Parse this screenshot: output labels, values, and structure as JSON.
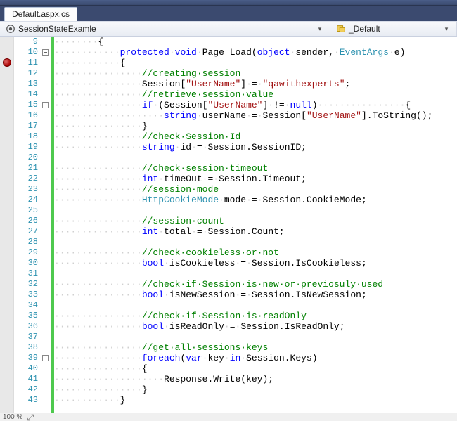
{
  "tab": {
    "filename": "Default.aspx.cs"
  },
  "nav": {
    "scope": "SessionStateExamle",
    "member_prefix": "",
    "member": "_Default"
  },
  "breakpoint_line": 11,
  "outline_toggles": [
    10,
    15,
    39
  ],
  "zoom": "100 %",
  "code_lines": [
    {
      "n": 9,
      "indent": 2,
      "tokens": [
        {
          "t": "txt",
          "v": "{"
        }
      ]
    },
    {
      "n": 10,
      "indent": 3,
      "tokens": [
        {
          "t": "kw",
          "v": "protected"
        },
        {
          "t": "ws",
          "v": "·"
        },
        {
          "t": "kw",
          "v": "void"
        },
        {
          "t": "ws",
          "v": "·"
        },
        {
          "t": "txt",
          "v": "Page_Load("
        },
        {
          "t": "kw",
          "v": "object"
        },
        {
          "t": "ws",
          "v": "·"
        },
        {
          "t": "txt",
          "v": "sender,"
        },
        {
          "t": "ws",
          "v": "·"
        },
        {
          "t": "type",
          "v": "EventArgs"
        },
        {
          "t": "ws",
          "v": "·"
        },
        {
          "t": "txt",
          "v": "e)"
        }
      ]
    },
    {
      "n": 11,
      "indent": 3,
      "tokens": [
        {
          "t": "txt",
          "v": "{"
        }
      ]
    },
    {
      "n": 12,
      "indent": 4,
      "tokens": [
        {
          "t": "cmt",
          "v": "//creating·session"
        }
      ]
    },
    {
      "n": 13,
      "indent": 4,
      "tokens": [
        {
          "t": "txt",
          "v": "Session["
        },
        {
          "t": "str",
          "v": "\"UserName\""
        },
        {
          "t": "txt",
          "v": "]"
        },
        {
          "t": "ws",
          "v": "·"
        },
        {
          "t": "txt",
          "v": "="
        },
        {
          "t": "ws",
          "v": "·"
        },
        {
          "t": "str",
          "v": "\"qawithexperts\""
        },
        {
          "t": "txt",
          "v": ";"
        }
      ]
    },
    {
      "n": 14,
      "indent": 4,
      "tokens": [
        {
          "t": "cmt",
          "v": "//retrieve·session·value"
        }
      ]
    },
    {
      "n": 15,
      "indent": 4,
      "tokens": [
        {
          "t": "kw",
          "v": "if"
        },
        {
          "t": "ws",
          "v": "·"
        },
        {
          "t": "txt",
          "v": "(Session["
        },
        {
          "t": "str",
          "v": "\"UserName\""
        },
        {
          "t": "txt",
          "v": "]"
        },
        {
          "t": "ws",
          "v": "·"
        },
        {
          "t": "txt",
          "v": "!="
        },
        {
          "t": "ws",
          "v": "·"
        },
        {
          "t": "kw",
          "v": "null"
        },
        {
          "t": "txt",
          "v": ")"
        },
        {
          "t": "ws",
          "v": "················"
        },
        {
          "t": "txt",
          "v": "{"
        }
      ]
    },
    {
      "n": 16,
      "indent": 5,
      "tokens": [
        {
          "t": "kw",
          "v": "string"
        },
        {
          "t": "ws",
          "v": "·"
        },
        {
          "t": "txt",
          "v": "userName"
        },
        {
          "t": "ws",
          "v": "·"
        },
        {
          "t": "txt",
          "v": "="
        },
        {
          "t": "ws",
          "v": "·"
        },
        {
          "t": "txt",
          "v": "Session["
        },
        {
          "t": "str",
          "v": "\"UserName\""
        },
        {
          "t": "txt",
          "v": "].ToString();"
        }
      ]
    },
    {
      "n": 17,
      "indent": 4,
      "tokens": [
        {
          "t": "txt",
          "v": "}"
        }
      ]
    },
    {
      "n": 18,
      "indent": 4,
      "tokens": [
        {
          "t": "cmt",
          "v": "//check·Session·Id"
        }
      ]
    },
    {
      "n": 19,
      "indent": 4,
      "tokens": [
        {
          "t": "kw",
          "v": "string"
        },
        {
          "t": "ws",
          "v": "·"
        },
        {
          "t": "txt",
          "v": "id"
        },
        {
          "t": "ws",
          "v": "·"
        },
        {
          "t": "txt",
          "v": "="
        },
        {
          "t": "ws",
          "v": "·"
        },
        {
          "t": "txt",
          "v": "Session.SessionID;"
        }
      ]
    },
    {
      "n": 20,
      "indent": 0,
      "tokens": []
    },
    {
      "n": 21,
      "indent": 4,
      "tokens": [
        {
          "t": "cmt",
          "v": "//check·session·timeout"
        }
      ]
    },
    {
      "n": 22,
      "indent": 4,
      "tokens": [
        {
          "t": "kw",
          "v": "int"
        },
        {
          "t": "ws",
          "v": "·"
        },
        {
          "t": "txt",
          "v": "timeOut"
        },
        {
          "t": "ws",
          "v": "·"
        },
        {
          "t": "txt",
          "v": "="
        },
        {
          "t": "ws",
          "v": "·"
        },
        {
          "t": "txt",
          "v": "Session.Timeout;"
        }
      ]
    },
    {
      "n": 23,
      "indent": 4,
      "tokens": [
        {
          "t": "cmt",
          "v": "//session·mode"
        }
      ]
    },
    {
      "n": 24,
      "indent": 4,
      "tokens": [
        {
          "t": "type",
          "v": "HttpCookieMode"
        },
        {
          "t": "ws",
          "v": "·"
        },
        {
          "t": "txt",
          "v": "mode"
        },
        {
          "t": "ws",
          "v": "·"
        },
        {
          "t": "txt",
          "v": "="
        },
        {
          "t": "ws",
          "v": "·"
        },
        {
          "t": "txt",
          "v": "Session.CookieMode;"
        }
      ]
    },
    {
      "n": 25,
      "indent": 0,
      "tokens": []
    },
    {
      "n": 26,
      "indent": 4,
      "tokens": [
        {
          "t": "cmt",
          "v": "//session·count"
        }
      ]
    },
    {
      "n": 27,
      "indent": 4,
      "tokens": [
        {
          "t": "kw",
          "v": "int"
        },
        {
          "t": "ws",
          "v": "·"
        },
        {
          "t": "txt",
          "v": "total"
        },
        {
          "t": "ws",
          "v": "·"
        },
        {
          "t": "txt",
          "v": "="
        },
        {
          "t": "ws",
          "v": "·"
        },
        {
          "t": "txt",
          "v": "Session.Count;"
        }
      ]
    },
    {
      "n": 28,
      "indent": 0,
      "tokens": []
    },
    {
      "n": 29,
      "indent": 4,
      "tokens": [
        {
          "t": "cmt",
          "v": "//check·cookieless·or·not"
        }
      ]
    },
    {
      "n": 30,
      "indent": 4,
      "tokens": [
        {
          "t": "kw",
          "v": "bool"
        },
        {
          "t": "ws",
          "v": "·"
        },
        {
          "t": "txt",
          "v": "isCookieless"
        },
        {
          "t": "ws",
          "v": "·"
        },
        {
          "t": "txt",
          "v": "="
        },
        {
          "t": "ws",
          "v": "·"
        },
        {
          "t": "txt",
          "v": "Session.IsCookieless;"
        }
      ]
    },
    {
      "n": 31,
      "indent": 0,
      "tokens": []
    },
    {
      "n": 32,
      "indent": 4,
      "tokens": [
        {
          "t": "cmt",
          "v": "//check·if·Session·is·new·or·previosuly·used"
        }
      ]
    },
    {
      "n": 33,
      "indent": 4,
      "tokens": [
        {
          "t": "kw",
          "v": "bool"
        },
        {
          "t": "ws",
          "v": "·"
        },
        {
          "t": "txt",
          "v": "isNewSession"
        },
        {
          "t": "ws",
          "v": "·"
        },
        {
          "t": "txt",
          "v": "="
        },
        {
          "t": "ws",
          "v": "·"
        },
        {
          "t": "txt",
          "v": "Session.IsNewSession;"
        }
      ]
    },
    {
      "n": 34,
      "indent": 0,
      "tokens": []
    },
    {
      "n": 35,
      "indent": 4,
      "tokens": [
        {
          "t": "cmt",
          "v": "//check·if·Session·is·readOnly"
        }
      ]
    },
    {
      "n": 36,
      "indent": 4,
      "tokens": [
        {
          "t": "kw",
          "v": "bool"
        },
        {
          "t": "ws",
          "v": "·"
        },
        {
          "t": "txt",
          "v": "isReadOnly"
        },
        {
          "t": "ws",
          "v": "·"
        },
        {
          "t": "txt",
          "v": "="
        },
        {
          "t": "ws",
          "v": "·"
        },
        {
          "t": "txt",
          "v": "Session.IsReadOnly;"
        }
      ]
    },
    {
      "n": 37,
      "indent": 0,
      "tokens": []
    },
    {
      "n": 38,
      "indent": 4,
      "tokens": [
        {
          "t": "cmt",
          "v": "//get·all·sessions·keys"
        }
      ]
    },
    {
      "n": 39,
      "indent": 4,
      "tokens": [
        {
          "t": "kw",
          "v": "foreach"
        },
        {
          "t": "txt",
          "v": "("
        },
        {
          "t": "kw",
          "v": "var"
        },
        {
          "t": "ws",
          "v": "·"
        },
        {
          "t": "txt",
          "v": "key"
        },
        {
          "t": "ws",
          "v": "·"
        },
        {
          "t": "kw",
          "v": "in"
        },
        {
          "t": "ws",
          "v": "·"
        },
        {
          "t": "txt",
          "v": "Session.Keys)"
        }
      ]
    },
    {
      "n": 40,
      "indent": 4,
      "tokens": [
        {
          "t": "txt",
          "v": "{"
        }
      ]
    },
    {
      "n": 41,
      "indent": 5,
      "tokens": [
        {
          "t": "txt",
          "v": "Response.Write(key);"
        }
      ]
    },
    {
      "n": 42,
      "indent": 4,
      "tokens": [
        {
          "t": "txt",
          "v": "}"
        }
      ]
    },
    {
      "n": 43,
      "indent": 3,
      "tokens": [
        {
          "t": "txt",
          "v": "}"
        }
      ]
    }
  ]
}
